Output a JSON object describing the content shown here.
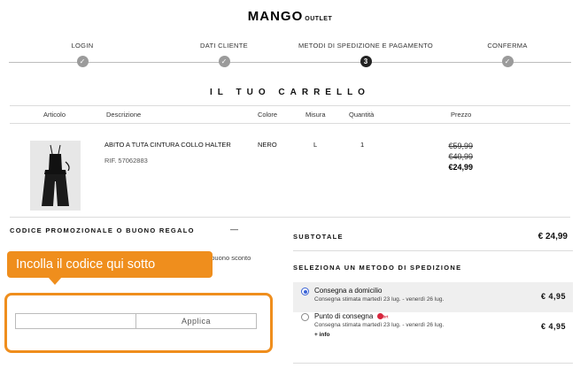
{
  "logo": {
    "brand": "MANGO",
    "sub": "OUTLET"
  },
  "steps": [
    {
      "label": "LOGIN",
      "marker": "✓",
      "active": false
    },
    {
      "label": "DATI CLIENTE",
      "marker": "✓",
      "active": false
    },
    {
      "label": "METODI DI SPEDIZIONE E PAGAMENTO",
      "marker": "3",
      "active": true
    },
    {
      "label": "CONFERMA",
      "marker": "✓",
      "active": false
    }
  ],
  "cart": {
    "title": "IL TUO CARRELLO",
    "columns": {
      "article": "Articolo",
      "description": "Descrizione",
      "color": "Colore",
      "size": "Misura",
      "quantity": "Quantità",
      "price": "Prezzo"
    },
    "item": {
      "name": "ABITO A TUTA CINTURA COLLO HALTER",
      "ref": "RIF. 57062883",
      "color": "NERO",
      "size": "L",
      "quantity": "1",
      "price_original": "€59,99",
      "price_previous": "€40,99",
      "price_final": "€24,99"
    }
  },
  "promo": {
    "title": "CODICE PROMOZIONALE O BUONO REGALO",
    "toggle": "—",
    "note": "o buono sconto",
    "input_value": "",
    "apply_label": "Applica"
  },
  "callout": {
    "text": "Incolla il codice qui sotto",
    "color": "#ef8e1d"
  },
  "summary": {
    "subtotal_label": "SUBTOTALE",
    "subtotal_value": "€ 24,99",
    "shipping_title": "SELEZIONA UN METODO DI SPEDIZIONE",
    "options": [
      {
        "name": "Consegna a domicilio",
        "estimate": "Consegna stimata martedì 23 lug. - venerdì 26 lug.",
        "price": "€ 4,95",
        "selected": true
      },
      {
        "name": "Punto di consegna",
        "carrier": "brt",
        "estimate": "Consegna stimata martedì 23 lug. - venerdì 26 lug.",
        "more": "+ info",
        "price": "€ 4,95",
        "selected": false
      }
    ]
  },
  "icons": {
    "check": "checkmark-icon",
    "carrier": "brt-logo-icon",
    "product": "product-thumbnail"
  }
}
